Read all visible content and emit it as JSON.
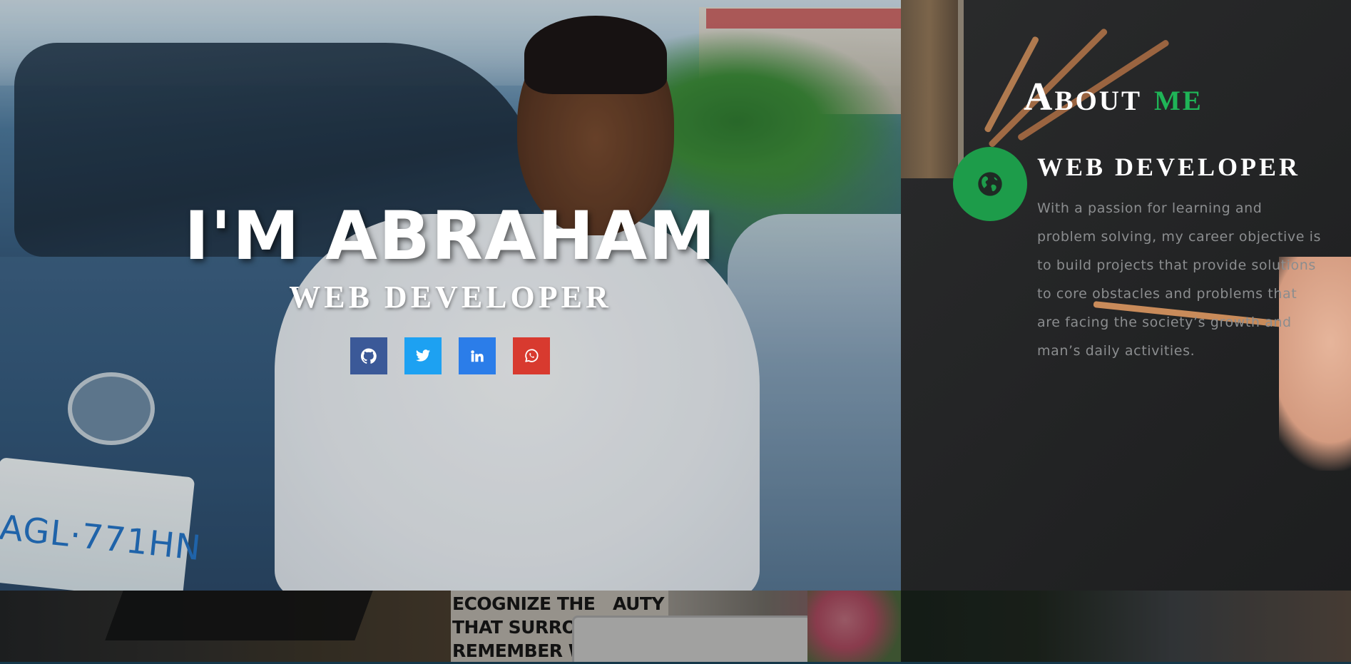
{
  "hero": {
    "title": "I'M ABRAHAM",
    "subtitle": "WEB DEVELOPER",
    "plate_text": "AGL·771HN",
    "socials": [
      {
        "name": "github",
        "icon": "github-icon",
        "color": "#3b5998"
      },
      {
        "name": "twitter",
        "icon": "twitter-icon",
        "color": "#1da1f2"
      },
      {
        "name": "linkedin",
        "icon": "linkedin-icon",
        "color": "#2b7de9"
      },
      {
        "name": "whatsapp",
        "icon": "whatsapp-icon",
        "color": "#d83a2f"
      }
    ]
  },
  "about": {
    "title_main": "About",
    "title_accent": "me",
    "accent_color": "#1fb457",
    "icon": "globe-icon",
    "role": "WEB DEVELOPER",
    "text": "With a passion for learning and problem solving, my career objective is to build projects that provide solutions to core obstacles and problems that are facing the society’s growth and man’s daily activities."
  },
  "strip": {
    "poster_text": "ECOGNIZE THE   AUTY\nTHAT SURROUN\nREMEMBER WHI\nAME FROM. PU"
  }
}
